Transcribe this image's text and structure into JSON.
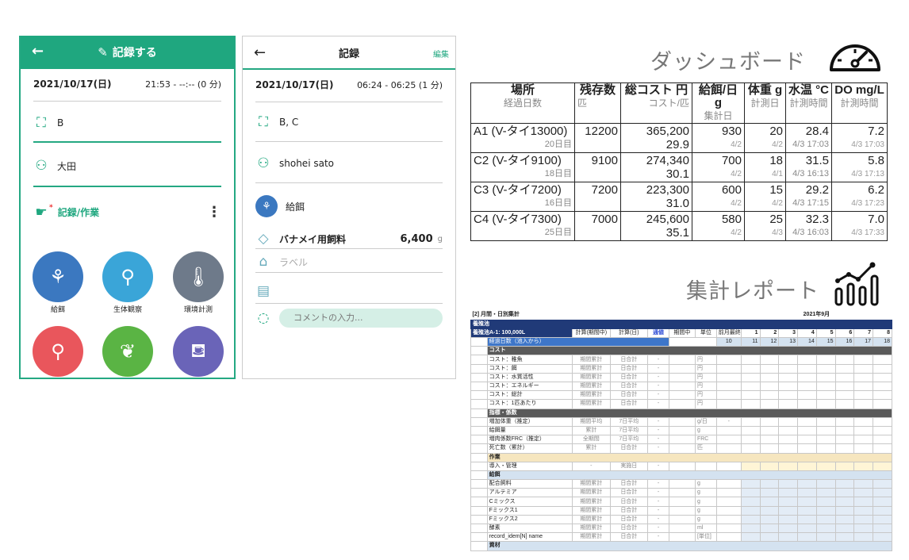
{
  "phone1": {
    "title": "記録する",
    "datetime": "2021/10/17(日)",
    "time_range": "21:53 - --:-- (0 分)",
    "location": "B",
    "person": "大田",
    "section_label": "記録/作業",
    "required_mark": "*",
    "tiles": [
      {
        "label": "給餌",
        "color": "#3b78c0",
        "icon": "feed-icon"
      },
      {
        "label": "生体観察",
        "color": "#3aa5d8",
        "icon": "magnifier-icon"
      },
      {
        "label": "環境計測",
        "color": "#6e7a8a",
        "icon": "thermometer-icon"
      },
      {
        "label": "",
        "color": "#e9565c",
        "icon": "magnifier-water-icon"
      },
      {
        "label": "",
        "color": "#5ab444",
        "icon": "shrimp-icon"
      },
      {
        "label": "",
        "color": "#6a64b8",
        "icon": "pour-icon"
      }
    ]
  },
  "phone2": {
    "title": "記録",
    "edit_label": "編集",
    "datetime": "2021/10/17(日)",
    "time_range": "06:24 - 06:25 (1 分)",
    "location": "B, C",
    "person": "shohei sato",
    "activity": "給餌",
    "feed_name": "バナメイ用飼料",
    "feed_amount": "6,400",
    "feed_unit": "g",
    "label_placeholder": "ラベル",
    "comment_placeholder": "コメントの入力..."
  },
  "dashboard": {
    "title": "ダッシュボード",
    "headers": [
      {
        "main": "場所",
        "sub": "経過日数"
      },
      {
        "main": "残存数",
        "sub": "匹"
      },
      {
        "main": "総コスト 円",
        "sub": "コスト/匹"
      },
      {
        "main": "給餌/日 g",
        "sub": "集計日"
      },
      {
        "main": "体重 g",
        "sub": "計測日"
      },
      {
        "main": "水温 °C",
        "sub": "計測時間"
      },
      {
        "main": "DO mg/L",
        "sub": "計測時間"
      }
    ],
    "rows": [
      {
        "place": "A1 (V-タイ13000)",
        "days": "20日目",
        "count": "12200",
        "cost": "365,200",
        "cost_per": "29.9",
        "feed": "930",
        "feed_date": "4/2",
        "weight": "20",
        "weight_date": "4/2",
        "temp": "28.4",
        "temp_time": "4/3 17:03",
        "do": "7.2",
        "do_time": "4/3 17:03"
      },
      {
        "place": "C2 (V-タイ9100)",
        "days": "18日目",
        "count": "9100",
        "cost": "274,340",
        "cost_per": "30.1",
        "feed": "700",
        "feed_date": "4/2",
        "weight": "18",
        "weight_date": "4/1",
        "temp": "31.5",
        "temp_time": "4/3 16:13",
        "do": "5.8",
        "do_time": "4/3 17:13"
      },
      {
        "place": "C3 (V-タイ7200)",
        "days": "16日目",
        "count": "7200",
        "cost": "223,300",
        "cost_per": "31.0",
        "feed": "600",
        "feed_date": "4/2",
        "weight": "15",
        "weight_date": "4/2",
        "temp": "29.2",
        "temp_time": "4/3 17:15",
        "do": "6.2",
        "do_time": "4/3 17:23"
      },
      {
        "place": "C4 (V-タイ7300)",
        "days": "25日目",
        "count": "7000",
        "cost": "245,600",
        "cost_per": "35.1",
        "feed": "580",
        "feed_date": "4/2",
        "weight": "25",
        "weight_date": "4/3",
        "temp": "32.3",
        "temp_time": "4/3 16:03",
        "do": "7.0",
        "do_time": "4/3 17:33"
      }
    ]
  },
  "report": {
    "title": "集計レポート",
    "sheet_title": "[2] 月間・日別集計",
    "month": "2021年9月",
    "pond": "養殖池",
    "pond_detail": "養殖池A-1: 100,000L",
    "col_headers": [
      "計算(期間中)",
      "計算(日)",
      "通値",
      "期間中",
      "単位",
      "前月最終"
    ],
    "days": [
      "1",
      "2",
      "3",
      "4",
      "5",
      "6",
      "7",
      "8"
    ],
    "elapsed_label": "経過日数（池入から）",
    "elapsed_prev": "10",
    "elapsed_days": [
      "11",
      "12",
      "13",
      "14",
      "15",
      "16",
      "17",
      "18"
    ],
    "rows": [
      {
        "kind": "sec",
        "label": "コスト"
      },
      {
        "kind": "row",
        "label": "コスト：稚魚",
        "a": "期間累計",
        "b": "日合計",
        "c": "-",
        "u": "円"
      },
      {
        "kind": "row",
        "label": "コスト：餌",
        "a": "期間累計",
        "b": "日合計",
        "c": "-",
        "u": "円"
      },
      {
        "kind": "row",
        "label": "コスト：水質活性",
        "a": "期間累計",
        "b": "日合計",
        "c": "-",
        "u": "円"
      },
      {
        "kind": "row",
        "label": "コスト：エネルギー",
        "a": "期間累計",
        "b": "日合計",
        "c": "-",
        "u": "円"
      },
      {
        "kind": "row",
        "label": "コスト：総計",
        "a": "期間累計",
        "b": "日合計",
        "c": "-",
        "u": "円"
      },
      {
        "kind": "row",
        "label": "コスト：1匹あたり",
        "a": "期間累計",
        "b": "日合計",
        "c": "-",
        "u": "円"
      },
      {
        "kind": "sec",
        "label": "指標・係数"
      },
      {
        "kind": "row",
        "label": "増加体重（推定）",
        "a": "期間平均",
        "b": "7日平均",
        "c": "-",
        "u": "g/日",
        "p": "-"
      },
      {
        "kind": "row",
        "label": "給餌量",
        "a": "累計",
        "b": "7日平均",
        "c": "-",
        "u": "g"
      },
      {
        "kind": "row",
        "label": "増肉係数FRC（推定）",
        "a": "全期間",
        "b": "7日平均",
        "c": "-",
        "u": "FRC"
      },
      {
        "kind": "row",
        "label": "死亡数（累計）",
        "a": "累計",
        "b": "日合計",
        "c": "-",
        "u": "匹"
      },
      {
        "kind": "yel",
        "label": "作業"
      },
      {
        "kind": "row",
        "label": "導入・管理",
        "a": "-",
        "b": "実施日",
        "c": "-",
        "u": "",
        "y": true
      },
      {
        "kind": "lb",
        "label": "給餌"
      },
      {
        "kind": "row",
        "label": "配合飼料",
        "a": "期間累計",
        "b": "日合計",
        "c": "-",
        "u": "g",
        "bl": true
      },
      {
        "kind": "row",
        "label": "アルテミア",
        "a": "期間累計",
        "b": "日合計",
        "c": "-",
        "u": "g",
        "bl": true
      },
      {
        "kind": "row",
        "label": "Cミックス",
        "a": "期間累計",
        "b": "日合計",
        "c": "-",
        "u": "g",
        "bl": true
      },
      {
        "kind": "row",
        "label": "Fミックス1",
        "a": "期間累計",
        "b": "日合計",
        "c": "-",
        "u": "g",
        "bl": true
      },
      {
        "kind": "row",
        "label": "Fミックス2",
        "a": "期間累計",
        "b": "日合計",
        "c": "-",
        "u": "g",
        "bl": true
      },
      {
        "kind": "row",
        "label": "酵素",
        "a": "期間累計",
        "b": "日合計",
        "c": "-",
        "u": "ml",
        "bl": true
      },
      {
        "kind": "row",
        "label": "record_idem[N] name",
        "a": "期間累計",
        "b": "日合計",
        "c": "-",
        "u": "[単位]",
        "bl": true
      },
      {
        "kind": "lb",
        "label": "資材"
      }
    ]
  }
}
